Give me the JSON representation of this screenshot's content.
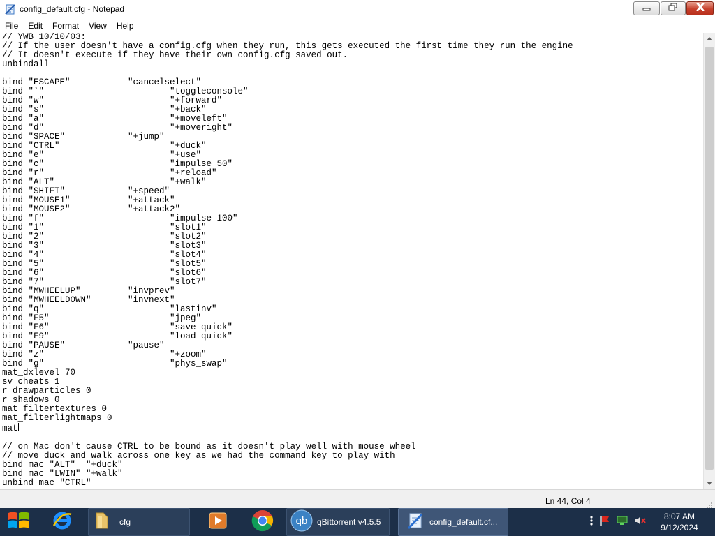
{
  "window": {
    "title": "config_default.cfg - Notepad",
    "minimize_icon": "minimize-icon",
    "maximize_icon": "restore-icon",
    "close_icon": "close-icon"
  },
  "menu": [
    "File",
    "Edit",
    "Format",
    "View",
    "Help"
  ],
  "editor": {
    "content": "// YWB 10/10/03:\n// If the user doesn't have a config.cfg when they run, this gets executed the first time they run the engine\n// It doesn't execute if they have their own config.cfg saved out.\nunbindall\n\nbind \"ESCAPE\"           \"cancelselect\"\nbind \"`\"                        \"toggleconsole\"\nbind \"w\"                        \"+forward\"\nbind \"s\"                        \"+back\"\nbind \"a\"                        \"+moveleft\"\nbind \"d\"                        \"+moveright\"\nbind \"SPACE\"            \"+jump\"\nbind \"CTRL\"                     \"+duck\"\nbind \"e\"                        \"+use\"\nbind \"c\"                        \"impulse 50\"\nbind \"r\"                        \"+reload\"\nbind \"ALT\"                      \"+walk\"\nbind \"SHIFT\"            \"+speed\"\nbind \"MOUSE1\"           \"+attack\"\nbind \"MOUSE2\"           \"+attack2\"\nbind \"f\"                        \"impulse 100\"\nbind \"1\"                        \"slot1\"\nbind \"2\"                        \"slot2\"\nbind \"3\"                        \"slot3\"\nbind \"4\"                        \"slot4\"\nbind \"5\"                        \"slot5\"\nbind \"6\"                        \"slot6\"\nbind \"7\"                        \"slot7\"\nbind \"MWHEELUP\"         \"invprev\"\nbind \"MWHEELDOWN\"       \"invnext\"\nbind \"q\"                        \"lastinv\"\nbind \"F5\"                       \"jpeg\"\nbind \"F6\"                       \"save quick\"\nbind \"F9\"                       \"load quick\"\nbind \"PAUSE\"            \"pause\"\nbind \"z\"                        \"+zoom\"\nbind \"g\"                        \"phys_swap\"\nmat_dxlevel 70\nsv_cheats 1\nr_drawparticles 0\nr_shadows 0\nmat_filtertextures 0\nmat_filterlightmaps 0\nmat",
    "content_after_caret": "\n\n// on Mac don't cause CTRL to be bound as it doesn't play well with mouse wheel\n// move duck and walk across one key as we had the command key to play with\nbind_mac \"ALT\"  \"+duck\"\nbind_mac \"LWIN\" \"+walk\"\nunbind_mac \"CTRL\""
  },
  "status": {
    "position": "Ln 44, Col 4"
  },
  "taskbar": {
    "start_icon": "windows-logo-icon",
    "items": [
      {
        "label": "",
        "icon": "internet-explorer-icon"
      },
      {
        "label": "cfg",
        "icon": "folder-icon"
      },
      {
        "label": "",
        "icon": "media-player-icon"
      },
      {
        "label": "",
        "icon": "chrome-icon"
      },
      {
        "label": "qBittorrent v4.5.5",
        "icon": "qbittorrent-icon"
      },
      {
        "label": "config_default.cf...",
        "icon": "notepad-icon"
      }
    ],
    "tray_icons": [
      "show-hidden-icon",
      "flag-icon",
      "network-icon",
      "volume-muted-icon"
    ],
    "clock_time": "8:07 AM",
    "clock_date": "9/12/2024"
  }
}
